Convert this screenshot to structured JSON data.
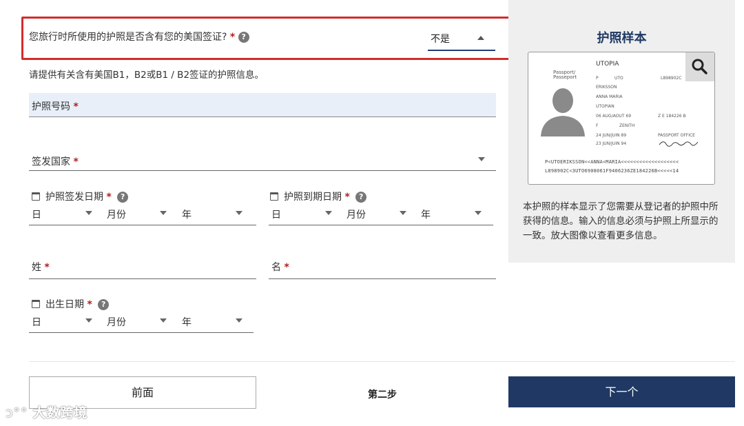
{
  "visa_question": {
    "label": "您旅行时所使用的护照是否含有您的美国签证?",
    "required_mark": "*",
    "help": "?",
    "value": "不是"
  },
  "hint": "请提供有关含有美国B1，B2或B1 / B2签证的护照信息。",
  "passport_number": {
    "label": "护照号码",
    "required_mark": "*"
  },
  "issuing_country": {
    "label": "签发国家",
    "required_mark": "*"
  },
  "issue_date": {
    "label": "护照签发日期",
    "required_mark": "*",
    "help": "?",
    "day": "日",
    "month": "月份",
    "year": "年"
  },
  "expiry_date": {
    "label": "护照到期日期",
    "required_mark": "*",
    "help": "?",
    "day": "日",
    "month": "月份",
    "year": "年"
  },
  "last_name": {
    "label": "姓",
    "required_mark": "*"
  },
  "first_name": {
    "label": "名",
    "required_mark": "*"
  },
  "birth_date": {
    "label": "出生日期",
    "required_mark": "*",
    "help": "?",
    "day": "日",
    "month": "月份",
    "year": "年"
  },
  "nav": {
    "prev": "前面",
    "step": "第二步",
    "next": "下一个"
  },
  "sidebar": {
    "title": "护照样本",
    "description": "本护照的样本显示了您需要从登记者的护照中所获得的信息。输入的信息必须与护照上所显示的一致。放大图像以查看更多信息。",
    "sample": {
      "passport_word": "Passport/ Passeport",
      "country": "UTOPIA",
      "type": "P",
      "code": "UTO",
      "number": "L898902C",
      "surname": "ERIKSSON",
      "given_names": "ANNA MARIA",
      "nationality": "UTOPIAN",
      "dob": "06 AUG/AOUT 69",
      "personal_no": "Z E 184226 B",
      "sex": "F",
      "birthplace": "ZENITH",
      "issue": "24 JUN/JUIN 89",
      "authority": "PASSPORT OFFICE",
      "expiry": "23 JUN/JUIN 94",
      "signature": "Anna Eriksson",
      "mrz1": "P<UTOERIKSSON<<ANNA<MARIA<<<<<<<<<<<<<<<<<<<",
      "mrz2": "L898902C<3UTO6908061F9406236ZE184226B<<<<<14"
    }
  },
  "watermark": "大数跨境",
  "colors": {
    "accent": "#1f3964",
    "highlight": "#d32b2b",
    "required": "#b01e1e",
    "field_bg": "#e8eff9"
  }
}
